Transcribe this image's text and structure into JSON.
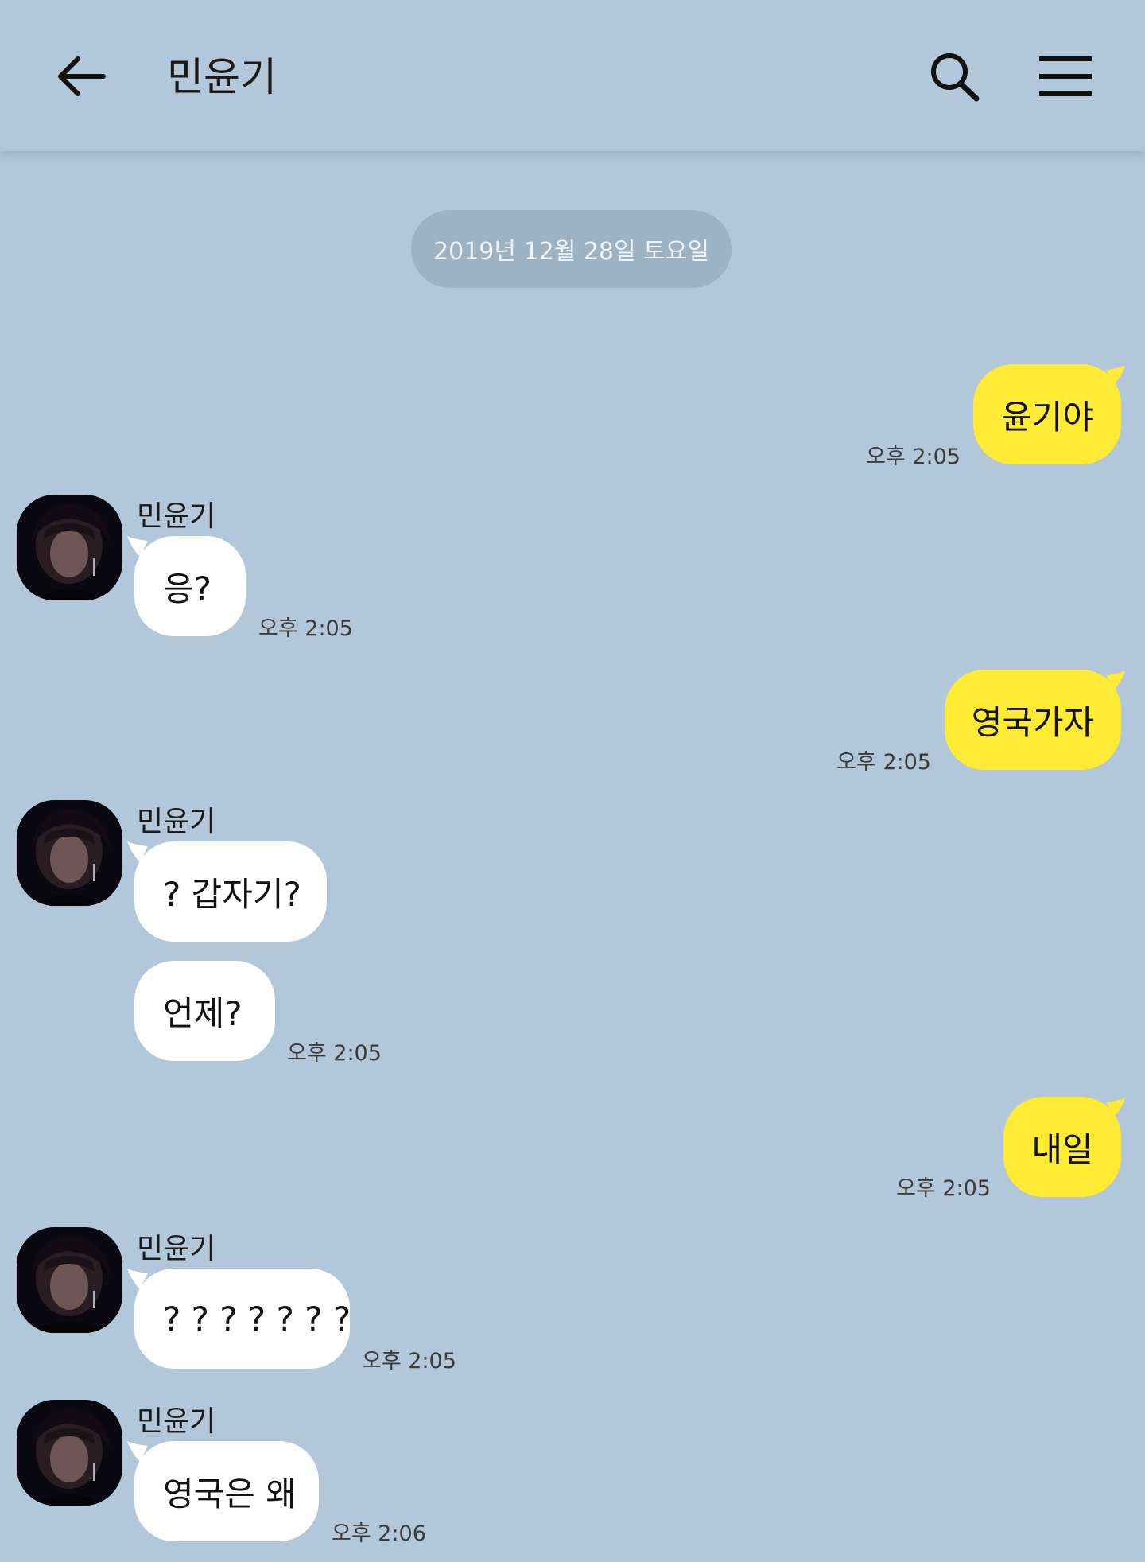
{
  "header": {
    "title": "민윤기",
    "back_icon": "arrow-left-icon",
    "search_icon": "search-icon",
    "menu_icon": "hamburger-menu-icon"
  },
  "date_divider": "2019년 12월 28일 토요일",
  "colors": {
    "background": "#b2c7da",
    "my_bubble": "#ffeb33",
    "their_bubble": "#ffffff"
  },
  "messages": [
    {
      "from": "me",
      "text": "윤기야",
      "time": "오후 2:05"
    },
    {
      "from": "them",
      "sender": "민윤기",
      "text": "응?",
      "time": "오후 2:05"
    },
    {
      "from": "me",
      "text": "영국가자",
      "time": "오후 2:05"
    },
    {
      "from": "them",
      "sender": "민윤기",
      "text": "? 갑자기?",
      "time": ""
    },
    {
      "from": "them",
      "sender": "",
      "text": "언제?",
      "time": "오후 2:05"
    },
    {
      "from": "me",
      "text": "내일",
      "time": "오후 2:05"
    },
    {
      "from": "them",
      "sender": "민윤기",
      "text": "? ? ? ? ? ? ?",
      "time": "오후 2:05"
    },
    {
      "from": "them",
      "sender": "민윤기",
      "text": "영국은 왜",
      "time": "오후 2:06"
    }
  ]
}
